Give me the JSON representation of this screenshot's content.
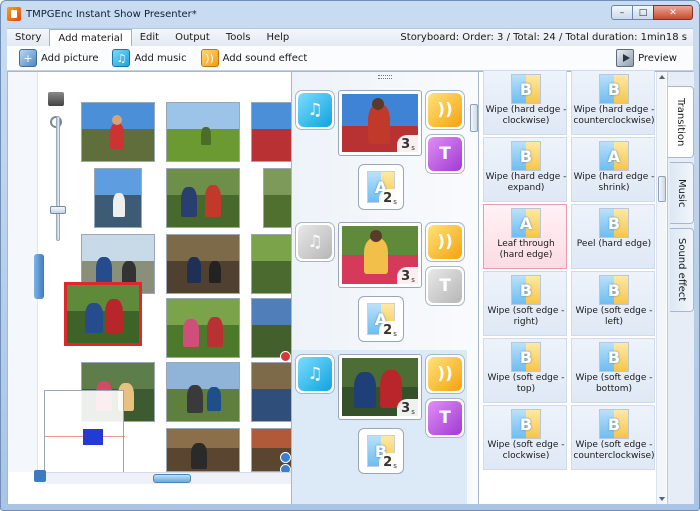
{
  "window": {
    "title": "TMPGEnc Instant Show Presenter*",
    "controls": {
      "minimize": "–",
      "maximize": "□",
      "close": "✕"
    }
  },
  "menu": {
    "items": [
      "Story",
      "Add material",
      "Edit",
      "Output",
      "Tools",
      "Help"
    ],
    "active": "Add material"
  },
  "storyboard_info": "Storyboard: Order: 3  /  Total: 24  /  Total duration: 1min18 s",
  "toolbar": {
    "add_picture": "Add picture",
    "add_music": "Add music",
    "add_sound_effect": "Add sound effect",
    "preview": "Preview"
  },
  "storyboard": {
    "clips": [
      {
        "duration": "3",
        "unit": "s",
        "music_on": true,
        "text_on": true
      },
      {
        "duration": "3",
        "unit": "s",
        "music_on": false,
        "text_on": false
      },
      {
        "duration": "3",
        "unit": "s",
        "music_on": true,
        "text_on": true
      }
    ],
    "transitions": [
      {
        "duration": "2",
        "unit": "s"
      },
      {
        "duration": "2",
        "unit": "s"
      },
      {
        "duration": "2",
        "unit": "s"
      }
    ]
  },
  "transitions": {
    "items": [
      {
        "label": "Wipe (hard edge - clockwise)",
        "letter": "B",
        "selected": false
      },
      {
        "label": "Wipe (hard edge - counterclockwise)",
        "letter": "B",
        "selected": false
      },
      {
        "label": "Wipe (hard edge - expand)",
        "letter": "B",
        "selected": false
      },
      {
        "label": "Wipe (hard edge - shrink)",
        "letter": "A",
        "selected": false
      },
      {
        "label": "Leaf through (hard edge)",
        "letter": "A",
        "selected": true
      },
      {
        "label": "Peel (hard edge)",
        "letter": "B",
        "selected": false
      },
      {
        "label": "Wipe (soft edge - right)",
        "letter": "B",
        "selected": false
      },
      {
        "label": "Wipe (soft edge - left)",
        "letter": "B",
        "selected": false
      },
      {
        "label": "Wipe (soft edge - top)",
        "letter": "B",
        "selected": false
      },
      {
        "label": "Wipe (soft edge - bottom)",
        "letter": "B",
        "selected": false
      },
      {
        "label": "Wipe (soft edge - clockwise)",
        "letter": "B",
        "selected": false
      },
      {
        "label": "Wipe (soft edge - counterclockwise)",
        "letter": "B",
        "selected": false
      }
    ]
  },
  "side_tabs": [
    "Transition",
    "Music",
    "Sound effect"
  ],
  "colors": {
    "accent": "#3c7bc2",
    "selection": "#e0282b",
    "music_tile": "#10a3df",
    "sound_tile": "#f5a20e",
    "text_tile": "#a03ad3"
  }
}
